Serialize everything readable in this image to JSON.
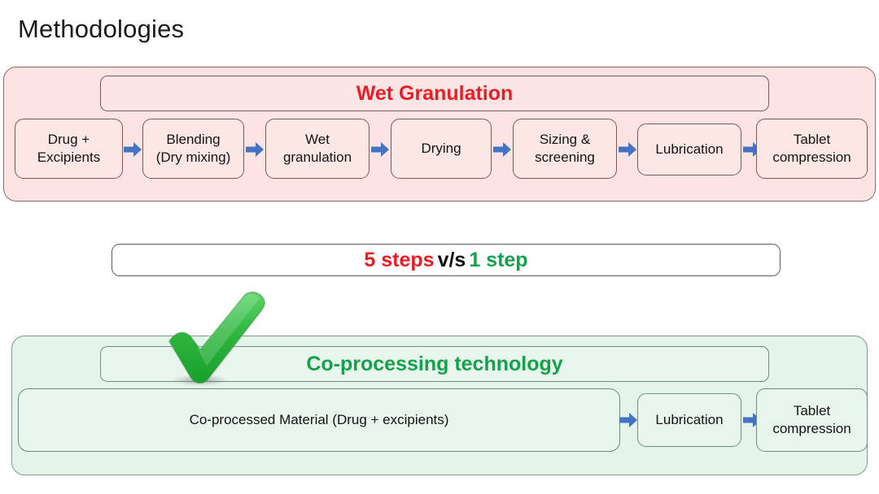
{
  "slide": {
    "title": "Methodologies"
  },
  "colors": {
    "red": "#ee1c25",
    "green": "#16a24c",
    "black": "#111111",
    "arrow_blue": "#4472c4",
    "pink_panel": "#fde4e4",
    "green_panel": "#e5f4ea",
    "pink_box": "#fce7e5",
    "green_box": "#e7f5ec"
  },
  "wet_granulation": {
    "header": "Wet Granulation",
    "steps": [
      {
        "lines": [
          "Drug +",
          "Excipients"
        ]
      },
      {
        "lines": [
          "Blending",
          "(Dry mixing)"
        ]
      },
      {
        "lines": [
          "Wet",
          "granulation"
        ]
      },
      {
        "lines": [
          "Drying"
        ]
      },
      {
        "lines": [
          "Sizing &",
          "screening"
        ]
      },
      {
        "lines": [
          "Lubrication"
        ]
      },
      {
        "lines": [
          "Tablet",
          "compression"
        ]
      }
    ]
  },
  "comparison": {
    "left": "5 steps",
    "middle": "v/s",
    "right": "1 step"
  },
  "co_processing": {
    "header": "Co-processing technology",
    "check_icon": "green-check-icon",
    "steps": [
      {
        "lines": [
          "Co-processed Material (Drug + excipients)"
        ]
      },
      {
        "lines": [
          "Lubrication"
        ]
      },
      {
        "lines": [
          "Tablet",
          "compression"
        ]
      }
    ]
  },
  "arrow_icon": "right-arrow-icon"
}
